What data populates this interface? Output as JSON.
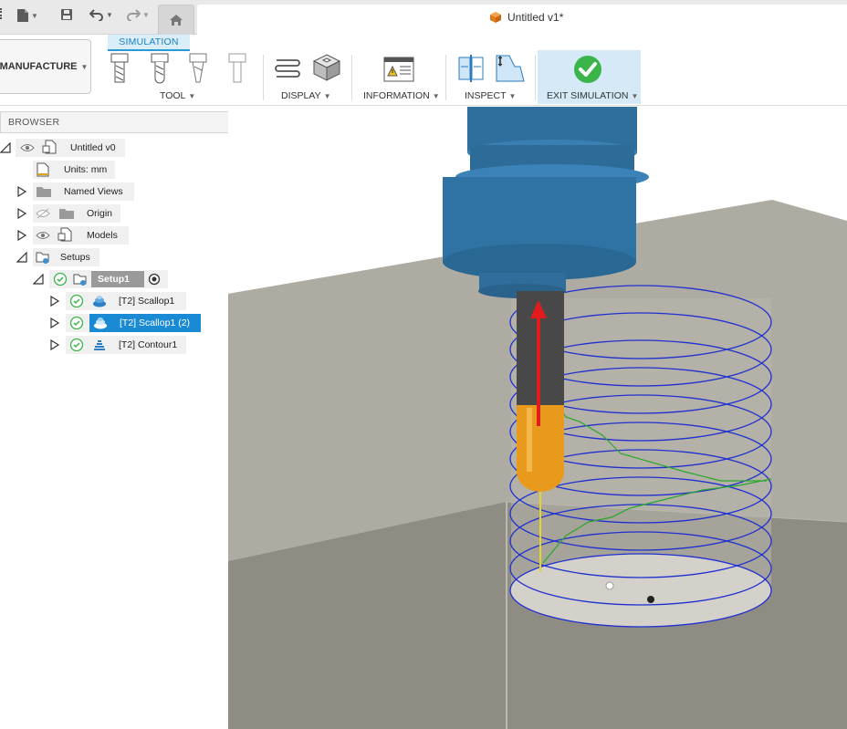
{
  "app": {
    "document_title": "Untitled v1*"
  },
  "ribbon": {
    "active_tab": "SIMULATION",
    "workspace_label": "MANUFACTURE",
    "groups": {
      "tool": "TOOL",
      "display": "DISPLAY",
      "information": "INFORMATION",
      "inspect": "INSPECT",
      "exit": "EXIT SIMULATION"
    }
  },
  "browser": {
    "title": "BROWSER",
    "root": "Untitled v0",
    "units": "Units: mm",
    "named_views": "Named Views",
    "origin": "Origin",
    "models": "Models",
    "setups": "Setups",
    "setup1": "Setup1",
    "ops": [
      "[T2] Scallop1",
      "[T2] Scallop1 (2)",
      "[T2] Contour1"
    ]
  },
  "colors": {
    "accent": "#1a8ad4",
    "spindle": "#2e6f9e",
    "toolpath": "#1f2fd0",
    "tool_tip": "#e89a1c",
    "stock": "#8f8c84",
    "exit_green": "#3bb54a"
  }
}
